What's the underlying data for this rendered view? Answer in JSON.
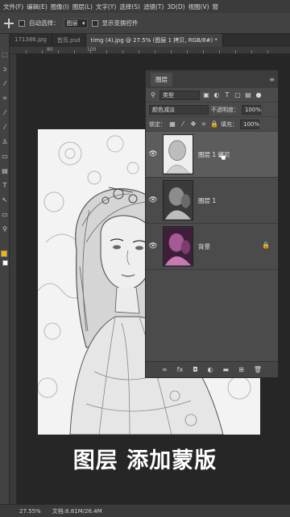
{
  "menu": [
    "文件(F)",
    "编辑(E)",
    "图像(I)",
    "图层(L)",
    "文字(Y)",
    "选择(S)",
    "滤镜(T)",
    "3D(D)",
    "视图(V)",
    "窗"
  ],
  "options": {
    "auto_select_label": "自动选择：",
    "auto_select_value": "图层",
    "show_transform_label": "显示变换控件"
  },
  "tabs": [
    {
      "label": "171386.jpg"
    },
    {
      "label": "首页.psd"
    },
    {
      "label": "timg (4).jpg @ 27.5% (图层 1 拷贝, RGB/8#) *"
    }
  ],
  "ruler_numbers": [
    "80",
    "100"
  ],
  "layers_panel": {
    "title": "图层",
    "filter_kind": "类型",
    "blend_mode": "颜色减淡",
    "opacity_label": "不透明度：",
    "opacity_value": "100%",
    "lock_label": "锁定：",
    "fill_label": "填充：",
    "fill_value": "100%",
    "layers": [
      {
        "name": "图层 1 拷贝",
        "selected": true,
        "visible": true,
        "locked": false
      },
      {
        "name": "图层 1",
        "selected": false,
        "visible": true,
        "locked": false
      },
      {
        "name": "背景",
        "selected": false,
        "visible": true,
        "locked": true
      }
    ]
  },
  "caption": "图层 添加蒙版",
  "status": {
    "zoom": "27.55%",
    "doc": "文档:8.81M/26.4M"
  },
  "colors": {
    "foreground": "#f2b600",
    "background": "#ffffff"
  }
}
